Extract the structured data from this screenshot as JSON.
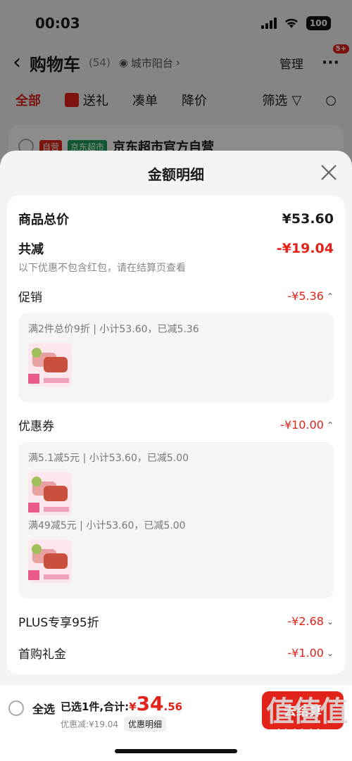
{
  "status": {
    "time": "00:03",
    "battery": "100"
  },
  "header": {
    "title": "购物车",
    "count": "(54)",
    "location": "城市阳台",
    "manage": "管理",
    "more": "···",
    "badge": "5+"
  },
  "tabs": {
    "all": "全部",
    "gift": "送礼",
    "bundle": "凑单",
    "price_drop": "降价",
    "filter": "筛选"
  },
  "shop": {
    "tag_self": "自营",
    "tag_market": "京东超市",
    "name": "京东超市官方自营"
  },
  "sheet": {
    "title": "金额明细",
    "total_label": "商品总价",
    "total_value": "¥53.60",
    "discount_label": "共减",
    "discount_value": "-¥19.04",
    "discount_note": "以下优惠不包含红包，请在结算页查看",
    "promo_label": "促销",
    "promo_value": "-¥5.36",
    "promo_line": "满2件总价9折 | 小计53.60，已减5.36",
    "coupon_label": "优惠券",
    "coupon_value": "-¥10.00",
    "coupon_line1": "满5.1减5元 | 小计53.60，已减5.00",
    "coupon_line2": "满49减5元 | 小计53.60，已减5.00",
    "plus_label": "PLUS专享95折",
    "plus_value": "-¥2.68",
    "first_label": "首购礼金",
    "first_value": "-¥1.00"
  },
  "bottom": {
    "select_all": "全选",
    "selected": "已选1件,合计:",
    "currency": "¥",
    "total_int": "34",
    "total_dec": ".56",
    "discount_sub": "优惠减:¥19.04",
    "detail_chip": "优惠明细",
    "checkout": "去结算"
  },
  "watermark": {
    "big": "值值值",
    "url": "zhizhizhi.com"
  }
}
